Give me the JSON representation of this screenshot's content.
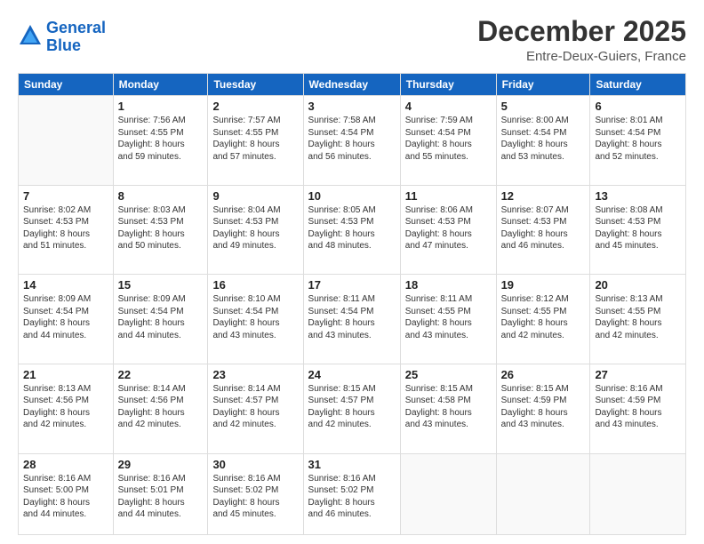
{
  "header": {
    "logo_line1": "General",
    "logo_line2": "Blue",
    "month": "December 2025",
    "location": "Entre-Deux-Guiers, France"
  },
  "weekdays": [
    "Sunday",
    "Monday",
    "Tuesday",
    "Wednesday",
    "Thursday",
    "Friday",
    "Saturday"
  ],
  "weeks": [
    [
      {
        "day": "",
        "info": ""
      },
      {
        "day": "1",
        "info": "Sunrise: 7:56 AM\nSunset: 4:55 PM\nDaylight: 8 hours\nand 59 minutes."
      },
      {
        "day": "2",
        "info": "Sunrise: 7:57 AM\nSunset: 4:55 PM\nDaylight: 8 hours\nand 57 minutes."
      },
      {
        "day": "3",
        "info": "Sunrise: 7:58 AM\nSunset: 4:54 PM\nDaylight: 8 hours\nand 56 minutes."
      },
      {
        "day": "4",
        "info": "Sunrise: 7:59 AM\nSunset: 4:54 PM\nDaylight: 8 hours\nand 55 minutes."
      },
      {
        "day": "5",
        "info": "Sunrise: 8:00 AM\nSunset: 4:54 PM\nDaylight: 8 hours\nand 53 minutes."
      },
      {
        "day": "6",
        "info": "Sunrise: 8:01 AM\nSunset: 4:54 PM\nDaylight: 8 hours\nand 52 minutes."
      }
    ],
    [
      {
        "day": "7",
        "info": "Sunrise: 8:02 AM\nSunset: 4:53 PM\nDaylight: 8 hours\nand 51 minutes."
      },
      {
        "day": "8",
        "info": "Sunrise: 8:03 AM\nSunset: 4:53 PM\nDaylight: 8 hours\nand 50 minutes."
      },
      {
        "day": "9",
        "info": "Sunrise: 8:04 AM\nSunset: 4:53 PM\nDaylight: 8 hours\nand 49 minutes."
      },
      {
        "day": "10",
        "info": "Sunrise: 8:05 AM\nSunset: 4:53 PM\nDaylight: 8 hours\nand 48 minutes."
      },
      {
        "day": "11",
        "info": "Sunrise: 8:06 AM\nSunset: 4:53 PM\nDaylight: 8 hours\nand 47 minutes."
      },
      {
        "day": "12",
        "info": "Sunrise: 8:07 AM\nSunset: 4:53 PM\nDaylight: 8 hours\nand 46 minutes."
      },
      {
        "day": "13",
        "info": "Sunrise: 8:08 AM\nSunset: 4:53 PM\nDaylight: 8 hours\nand 45 minutes."
      }
    ],
    [
      {
        "day": "14",
        "info": "Sunrise: 8:09 AM\nSunset: 4:54 PM\nDaylight: 8 hours\nand 44 minutes."
      },
      {
        "day": "15",
        "info": "Sunrise: 8:09 AM\nSunset: 4:54 PM\nDaylight: 8 hours\nand 44 minutes."
      },
      {
        "day": "16",
        "info": "Sunrise: 8:10 AM\nSunset: 4:54 PM\nDaylight: 8 hours\nand 43 minutes."
      },
      {
        "day": "17",
        "info": "Sunrise: 8:11 AM\nSunset: 4:54 PM\nDaylight: 8 hours\nand 43 minutes."
      },
      {
        "day": "18",
        "info": "Sunrise: 8:11 AM\nSunset: 4:55 PM\nDaylight: 8 hours\nand 43 minutes."
      },
      {
        "day": "19",
        "info": "Sunrise: 8:12 AM\nSunset: 4:55 PM\nDaylight: 8 hours\nand 42 minutes."
      },
      {
        "day": "20",
        "info": "Sunrise: 8:13 AM\nSunset: 4:55 PM\nDaylight: 8 hours\nand 42 minutes."
      }
    ],
    [
      {
        "day": "21",
        "info": "Sunrise: 8:13 AM\nSunset: 4:56 PM\nDaylight: 8 hours\nand 42 minutes."
      },
      {
        "day": "22",
        "info": "Sunrise: 8:14 AM\nSunset: 4:56 PM\nDaylight: 8 hours\nand 42 minutes."
      },
      {
        "day": "23",
        "info": "Sunrise: 8:14 AM\nSunset: 4:57 PM\nDaylight: 8 hours\nand 42 minutes."
      },
      {
        "day": "24",
        "info": "Sunrise: 8:15 AM\nSunset: 4:57 PM\nDaylight: 8 hours\nand 42 minutes."
      },
      {
        "day": "25",
        "info": "Sunrise: 8:15 AM\nSunset: 4:58 PM\nDaylight: 8 hours\nand 43 minutes."
      },
      {
        "day": "26",
        "info": "Sunrise: 8:15 AM\nSunset: 4:59 PM\nDaylight: 8 hours\nand 43 minutes."
      },
      {
        "day": "27",
        "info": "Sunrise: 8:16 AM\nSunset: 4:59 PM\nDaylight: 8 hours\nand 43 minutes."
      }
    ],
    [
      {
        "day": "28",
        "info": "Sunrise: 8:16 AM\nSunset: 5:00 PM\nDaylight: 8 hours\nand 44 minutes."
      },
      {
        "day": "29",
        "info": "Sunrise: 8:16 AM\nSunset: 5:01 PM\nDaylight: 8 hours\nand 44 minutes."
      },
      {
        "day": "30",
        "info": "Sunrise: 8:16 AM\nSunset: 5:02 PM\nDaylight: 8 hours\nand 45 minutes."
      },
      {
        "day": "31",
        "info": "Sunrise: 8:16 AM\nSunset: 5:02 PM\nDaylight: 8 hours\nand 46 minutes."
      },
      {
        "day": "",
        "info": ""
      },
      {
        "day": "",
        "info": ""
      },
      {
        "day": "",
        "info": ""
      }
    ]
  ]
}
